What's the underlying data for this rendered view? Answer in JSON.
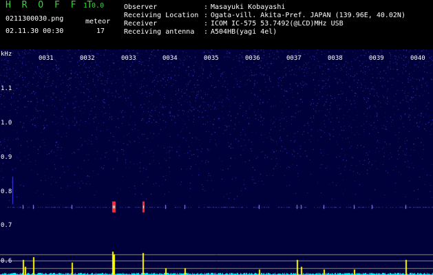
{
  "header": {
    "app_name": "H R O F F T",
    "app_version": "1.0.0",
    "filename": "0211300030.png",
    "meteor_label": "meteor",
    "datetime": "02.11.30 00:30",
    "meteor_count": "17",
    "info": [
      {
        "label": "Observer",
        "sep": ":",
        "value": "Masayuki Kobayashi"
      },
      {
        "label": "Receiving Location",
        "sep": ":",
        "value": "Ogata-vill. Akita-Pref. JAPAN (139.96E, 40.02N)"
      },
      {
        "label": "Receiver",
        "sep": ":",
        "value": "ICOM IC-575 53.7492(@LCD)MHz USB"
      },
      {
        "label": "Receiving antenna",
        "sep": ":",
        "value": "A504HB(yagi 4el)"
      }
    ]
  },
  "spectrogram": {
    "unit": "kHz",
    "y_labels": [
      "1.1",
      "1.0",
      "0.9",
      "0.8",
      "0.7",
      "0.6"
    ],
    "x_ticks": [
      "0031",
      "0032",
      "0033",
      "0034",
      "0035",
      "0036",
      "0037",
      "0038",
      "0039",
      "0040"
    ],
    "colors": {
      "background": "#00003a",
      "noise": "#2a2aff",
      "meteor": "#ff3030",
      "level": "#ffff00",
      "baseline": "#00ffff",
      "grid": "#ffffff"
    }
  }
}
